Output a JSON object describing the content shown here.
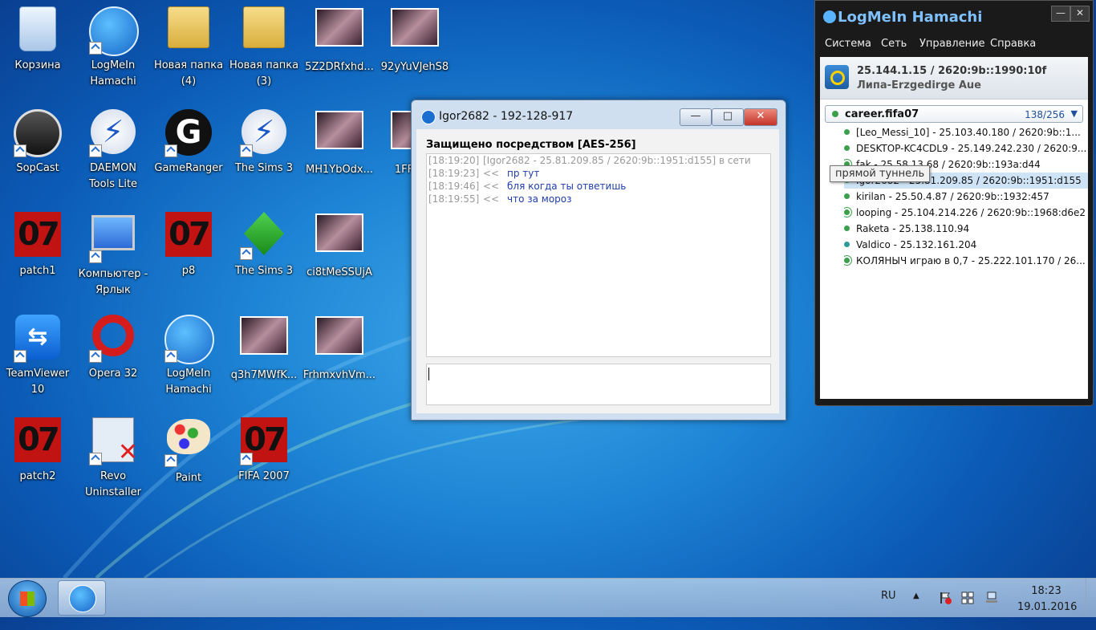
{
  "desktop": {
    "icons": [
      {
        "label": "Корзина"
      },
      {
        "label": "LogMeIn Hamachi"
      },
      {
        "label": "Новая папка (4)"
      },
      {
        "label": "Новая папка (3)"
      },
      {
        "label": "5Z2DRfxhd..."
      },
      {
        "label": "92yYuVJehS8"
      },
      {
        "label": "SopCast"
      },
      {
        "label": "DAEMON Tools Lite"
      },
      {
        "label": "GameRanger"
      },
      {
        "label": "The Sims 3"
      },
      {
        "label": "MH1YbOdx..."
      },
      {
        "label": "1FFnT..."
      },
      {
        "label": "patch1"
      },
      {
        "label": "Компьютер - Ярлык"
      },
      {
        "label": "p8"
      },
      {
        "label": "The Sims 3"
      },
      {
        "label": "ci8tMeSSUjA"
      },
      {
        "label": "TeamViewer 10"
      },
      {
        "label": "Opera 32"
      },
      {
        "label": "LogMeIn Hamachi"
      },
      {
        "label": "q3h7MWfK..."
      },
      {
        "label": "FrhmxvhVm..."
      },
      {
        "label": "patch2"
      },
      {
        "label": "Revo Uninstaller"
      },
      {
        "label": "Paint"
      },
      {
        "label": "FIFA 2007"
      }
    ],
    "red_badge_text": "07",
    "gameranger_letter": "G",
    "teamviewer_glyph": "⇆",
    "daemon_glyph": "⚡"
  },
  "chat": {
    "title": "Igor2682 - 192-128-917",
    "minimize": "—",
    "maximize": "□",
    "close": "✕",
    "secure_label": "Защищено посредством [AES-256]",
    "lines": [
      {
        "time": "[18:19:20]",
        "dir": "",
        "text": "[Igor2682 - 25.81.209.85 / 2620:9b::1951:d155] в сети"
      },
      {
        "time": "[18:19:23]",
        "dir": "<<",
        "text": "пр тут"
      },
      {
        "time": "[18:19:46]",
        "dir": "<<",
        "text": "бля когда ты ответишь"
      },
      {
        "time": "[18:19:55]",
        "dir": "<<",
        "text": "что за мороз"
      }
    ],
    "input_value": ""
  },
  "hamachi": {
    "title": "LogMeIn Hamachi",
    "minimize": "—",
    "close": "✕",
    "menu": [
      "Система",
      "Сеть",
      "Управление",
      "Справка"
    ],
    "ip": "25.144.1.15 / 2620:9b::1990:10f",
    "name": "Липа-Erzgedirge Aue",
    "network": {
      "name": "career.fifa07",
      "count": "138/256",
      "chevron": "▼"
    },
    "members": [
      {
        "text": "[Leo_Messi_10] - 25.103.40.180 / 2620:9b::1..."
      },
      {
        "text": "DESKTOP-KC4CDL9 - 25.149.242.230 / 2620:9..."
      },
      {
        "text": "fak - 25.58.13.68 / 2620:9b::193a:d44"
      },
      {
        "text": "Igor2682 - 25.81.209.85 / 2620:9b::1951:d155"
      },
      {
        "text": "kirilan - 25.50.4.87 / 2620:9b::1932:457"
      },
      {
        "text": "looping - 25.104.214.226 / 2620:9b::1968:d6e2"
      },
      {
        "text": "Raketa - 25.138.110.94"
      },
      {
        "text": "Valdico - 25.132.161.204"
      },
      {
        "text": "КОЛЯНЫЧ играю в 0,7 - 25.222.101.170 / 26..."
      }
    ],
    "tooltip": "прямой туннель"
  },
  "taskbar": {
    "lang": "RU",
    "tray_up": "▲",
    "time": "18:23",
    "date": "19.01.2016"
  },
  "colors": {
    "accent": "#1b6fd0",
    "online": "#3aa14a",
    "badge_red": "#c21313"
  }
}
